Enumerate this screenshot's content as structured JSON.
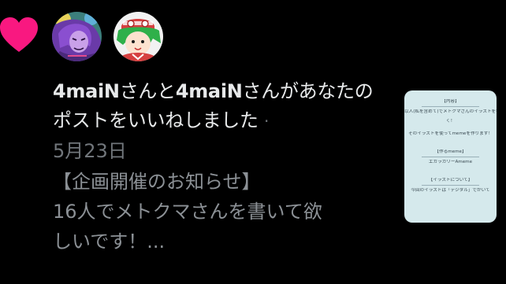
{
  "notification": {
    "actor_1": "4maiN",
    "connector": "さんと",
    "actor_2": "4maiN",
    "action_text": "さんがあなたのポストをいいねしました",
    "separator": "·",
    "date": "5月23日",
    "post_lines": [
      "【企画開催のお知らせ】",
      "16人でメトクマさんを書いて欲",
      "しいです！..."
    ]
  },
  "icons": {
    "like": "heart-icon",
    "like_color": "#f91880"
  },
  "avatars": [
    {
      "name": "avatar-purple-hair",
      "bg": "#3c7f7c"
    },
    {
      "name": "avatar-green-hair",
      "bg": "#f2f2f2"
    }
  ],
  "thumbnail": {
    "lines": [
      "【内容】",
      "以人(私を含めて)でメトクマさんのイラストを書",
      "く！",
      "そのイラストを使ってmemeを作ります！",
      "【作るmeme】",
      "エガラガリーAmeme",
      "【イラストについて】",
      "今回のイラストは「デジタル」でかいて"
    ]
  }
}
